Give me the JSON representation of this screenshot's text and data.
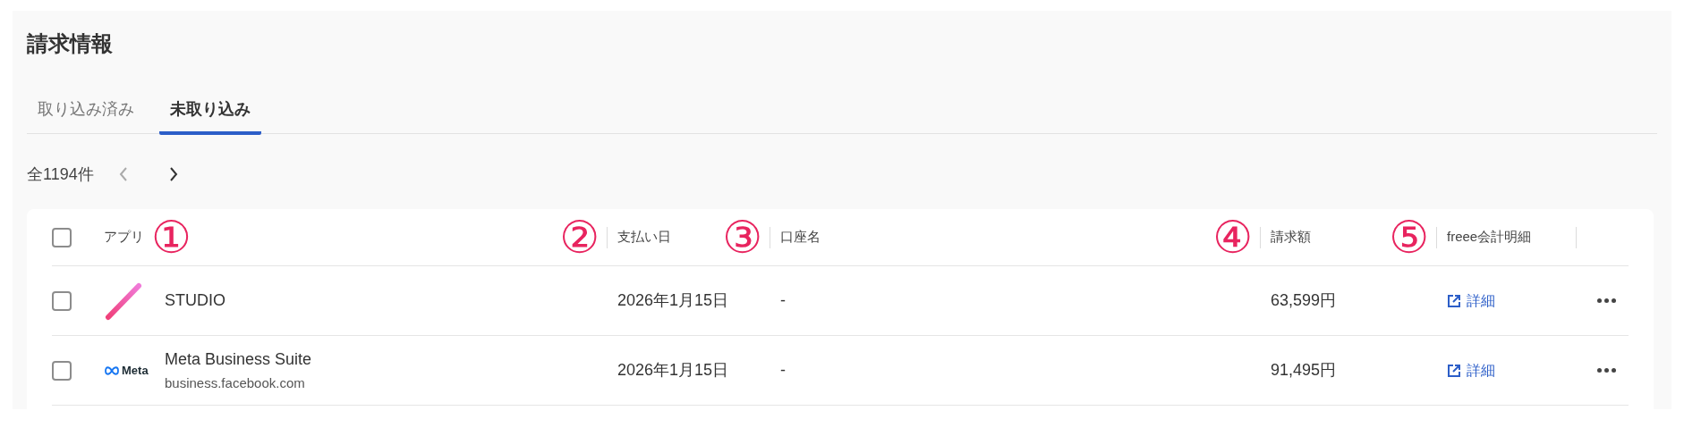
{
  "title": "請求情報",
  "tabs": [
    {
      "label": "取り込み済み",
      "selected": false
    },
    {
      "label": "未取り込み",
      "selected": true
    }
  ],
  "pagination": {
    "count": "全1194件",
    "prev_disabled": true
  },
  "table": {
    "select_all_checked": false,
    "columns": [
      {
        "label": "アプリ",
        "marker": "①"
      },
      {
        "label": "支払い日",
        "marker": "②"
      },
      {
        "label": "口座名",
        "marker": "③"
      },
      {
        "label": "請求額",
        "marker": "④"
      },
      {
        "label": "freee会計明細",
        "marker": "⑤"
      }
    ],
    "rows": [
      {
        "checked": false,
        "logo": {
          "kind": "studio"
        },
        "app": "STUDIO",
        "date": "2026年1月15日",
        "account": "-",
        "amount": "63,599円",
        "link": "詳細"
      },
      {
        "checked": false,
        "logo": {
          "kind": "meta",
          "text": "Meta"
        },
        "app": "Meta Business Suite",
        "domain": "business.facebook.com",
        "date": "2026年1月15日",
        "account": "-",
        "amount": "91,495円",
        "link": "詳細"
      }
    ]
  }
}
